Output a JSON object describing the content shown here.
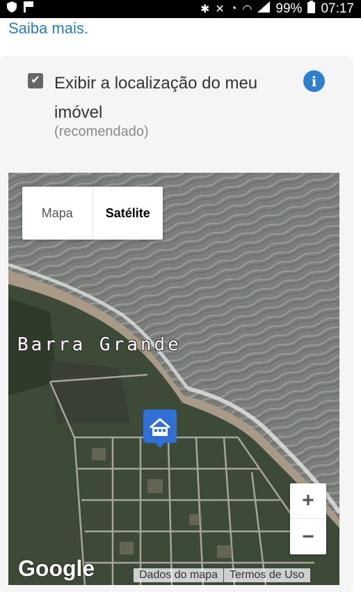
{
  "status_bar": {
    "battery": "99%",
    "time": "07:17",
    "icons": [
      "shield-icon",
      "flag-icon",
      "bluetooth-icon",
      "mute-icon",
      "alarm-icon",
      "wifi-icon",
      "signal-icon",
      "battery-icon"
    ]
  },
  "learn_more_link": "Saiba mais.",
  "location_option": {
    "checked": true,
    "label": "Exibir a localização do meu imóvel",
    "hint": "(recomendado)"
  },
  "map": {
    "type_tabs": [
      "Mapa",
      "Satélite"
    ],
    "active_tab": "Satélite",
    "place_label": "Barra Grande",
    "zoom_in": "+",
    "zoom_out": "−",
    "provider": "Google",
    "attribution": [
      "Dados do mapa",
      "Termos de Uso"
    ],
    "marker_icon": "house-marker-icon",
    "marker_color": "#2f6fd6"
  }
}
